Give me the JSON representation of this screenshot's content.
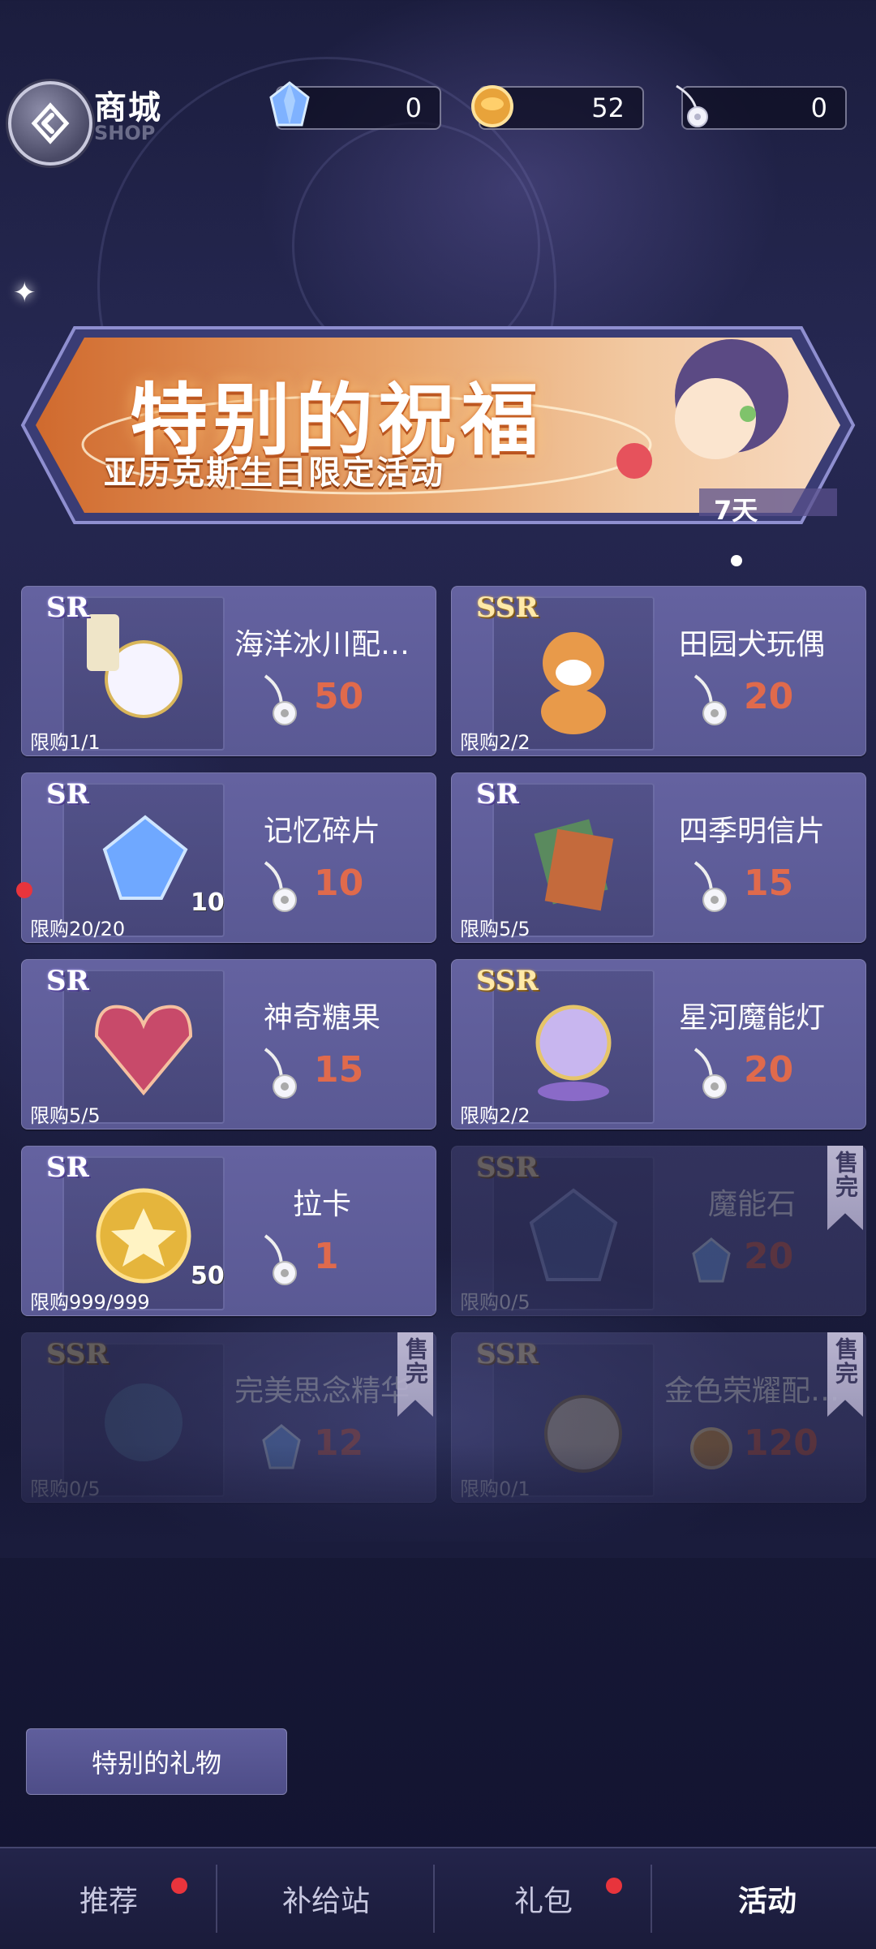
{
  "header": {
    "title": "商城",
    "subtitle": "SHOP"
  },
  "currencies": [
    {
      "icon": "crystal-icon",
      "value": "0"
    },
    {
      "icon": "gold-coin-icon",
      "value": "52"
    },
    {
      "icon": "flower-pendant-icon",
      "value": "0"
    }
  ],
  "banner": {
    "title": "特别的祝福",
    "subtitle": "亚历克斯生日限定活动",
    "days": "7天"
  },
  "items": [
    {
      "rarity": "SR",
      "name": "海洋冰川配…",
      "price": "50",
      "currency_icon": "flower-pendant-icon",
      "limit": "限购1/1",
      "qty": "",
      "sold_out": false,
      "image": "earrings-icon"
    },
    {
      "rarity": "SSR",
      "name": "田园犬玩偶",
      "price": "20",
      "currency_icon": "flower-pendant-icon",
      "limit": "限购2/2",
      "qty": "",
      "sold_out": false,
      "image": "shiba-doll-icon"
    },
    {
      "rarity": "SR",
      "name": "记忆碎片",
      "price": "10",
      "currency_icon": "flower-pendant-icon",
      "limit": "限购20/20",
      "qty": "10",
      "sold_out": false,
      "image": "memory-crystal-icon"
    },
    {
      "rarity": "SR",
      "name": "四季明信片",
      "price": "15",
      "currency_icon": "flower-pendant-icon",
      "limit": "限购5/5",
      "qty": "",
      "sold_out": false,
      "image": "postcards-icon"
    },
    {
      "rarity": "SR",
      "name": "神奇糖果",
      "price": "15",
      "currency_icon": "flower-pendant-icon",
      "limit": "限购5/5",
      "qty": "",
      "sold_out": false,
      "image": "candy-box-icon"
    },
    {
      "rarity": "SSR",
      "name": "星河魔能灯",
      "price": "20",
      "currency_icon": "flower-pendant-icon",
      "limit": "限购2/2",
      "qty": "",
      "sold_out": false,
      "image": "magic-lamp-icon"
    },
    {
      "rarity": "SR",
      "name": "拉卡",
      "price": "1",
      "currency_icon": "flower-pendant-icon",
      "limit": "限购999/999",
      "qty": "50",
      "sold_out": false,
      "image": "raka-coin-icon"
    },
    {
      "rarity": "SSR",
      "name": "魔能石",
      "price": "20",
      "currency_icon": "crystal-icon",
      "limit": "限购0/5",
      "qty": "",
      "sold_out": true,
      "image": "magic-stone-icon"
    },
    {
      "rarity": "SSR",
      "name": "完美思念精华",
      "price": "12",
      "currency_icon": "crystal-icon",
      "limit": "限购0/5",
      "qty": "",
      "sold_out": true,
      "image": "essence-icon"
    },
    {
      "rarity": "SSR",
      "name": "金色荣耀配…",
      "price": "120",
      "currency_icon": "gold-coin-icon",
      "limit": "限购0/1",
      "qty": "",
      "sold_out": true,
      "image": "golden-badge-icon"
    }
  ],
  "sold_label": "售完",
  "gift_button": "特别的礼物",
  "nav": [
    {
      "label": "推荐",
      "badge": true,
      "active": false
    },
    {
      "label": "补给站",
      "badge": false,
      "active": false
    },
    {
      "label": "礼包",
      "badge": true,
      "active": false
    },
    {
      "label": "活动",
      "badge": false,
      "active": true
    }
  ]
}
